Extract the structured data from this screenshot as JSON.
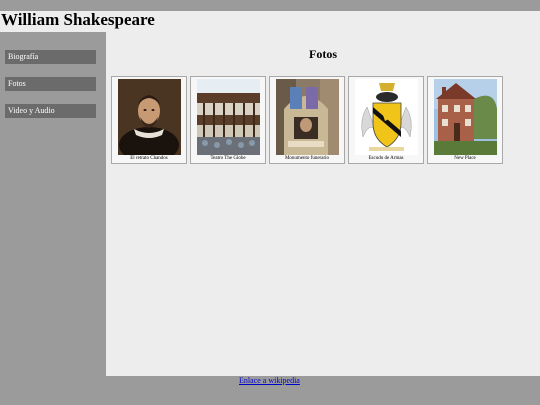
{
  "site": {
    "title": "William Shakespeare"
  },
  "nav": {
    "items": [
      {
        "label": "Biografía"
      },
      {
        "label": "Fotos"
      },
      {
        "label": "Video y Audio"
      }
    ]
  },
  "main": {
    "title": "Fotos",
    "photos": [
      {
        "caption": "El retrato Chandos"
      },
      {
        "caption": "Teatro The Globe"
      },
      {
        "caption": "Monumento funerario"
      },
      {
        "caption": "Escudo de Armas"
      },
      {
        "caption": "New Place"
      }
    ]
  },
  "footer": {
    "link_label": "Enlace a wikipedia"
  }
}
